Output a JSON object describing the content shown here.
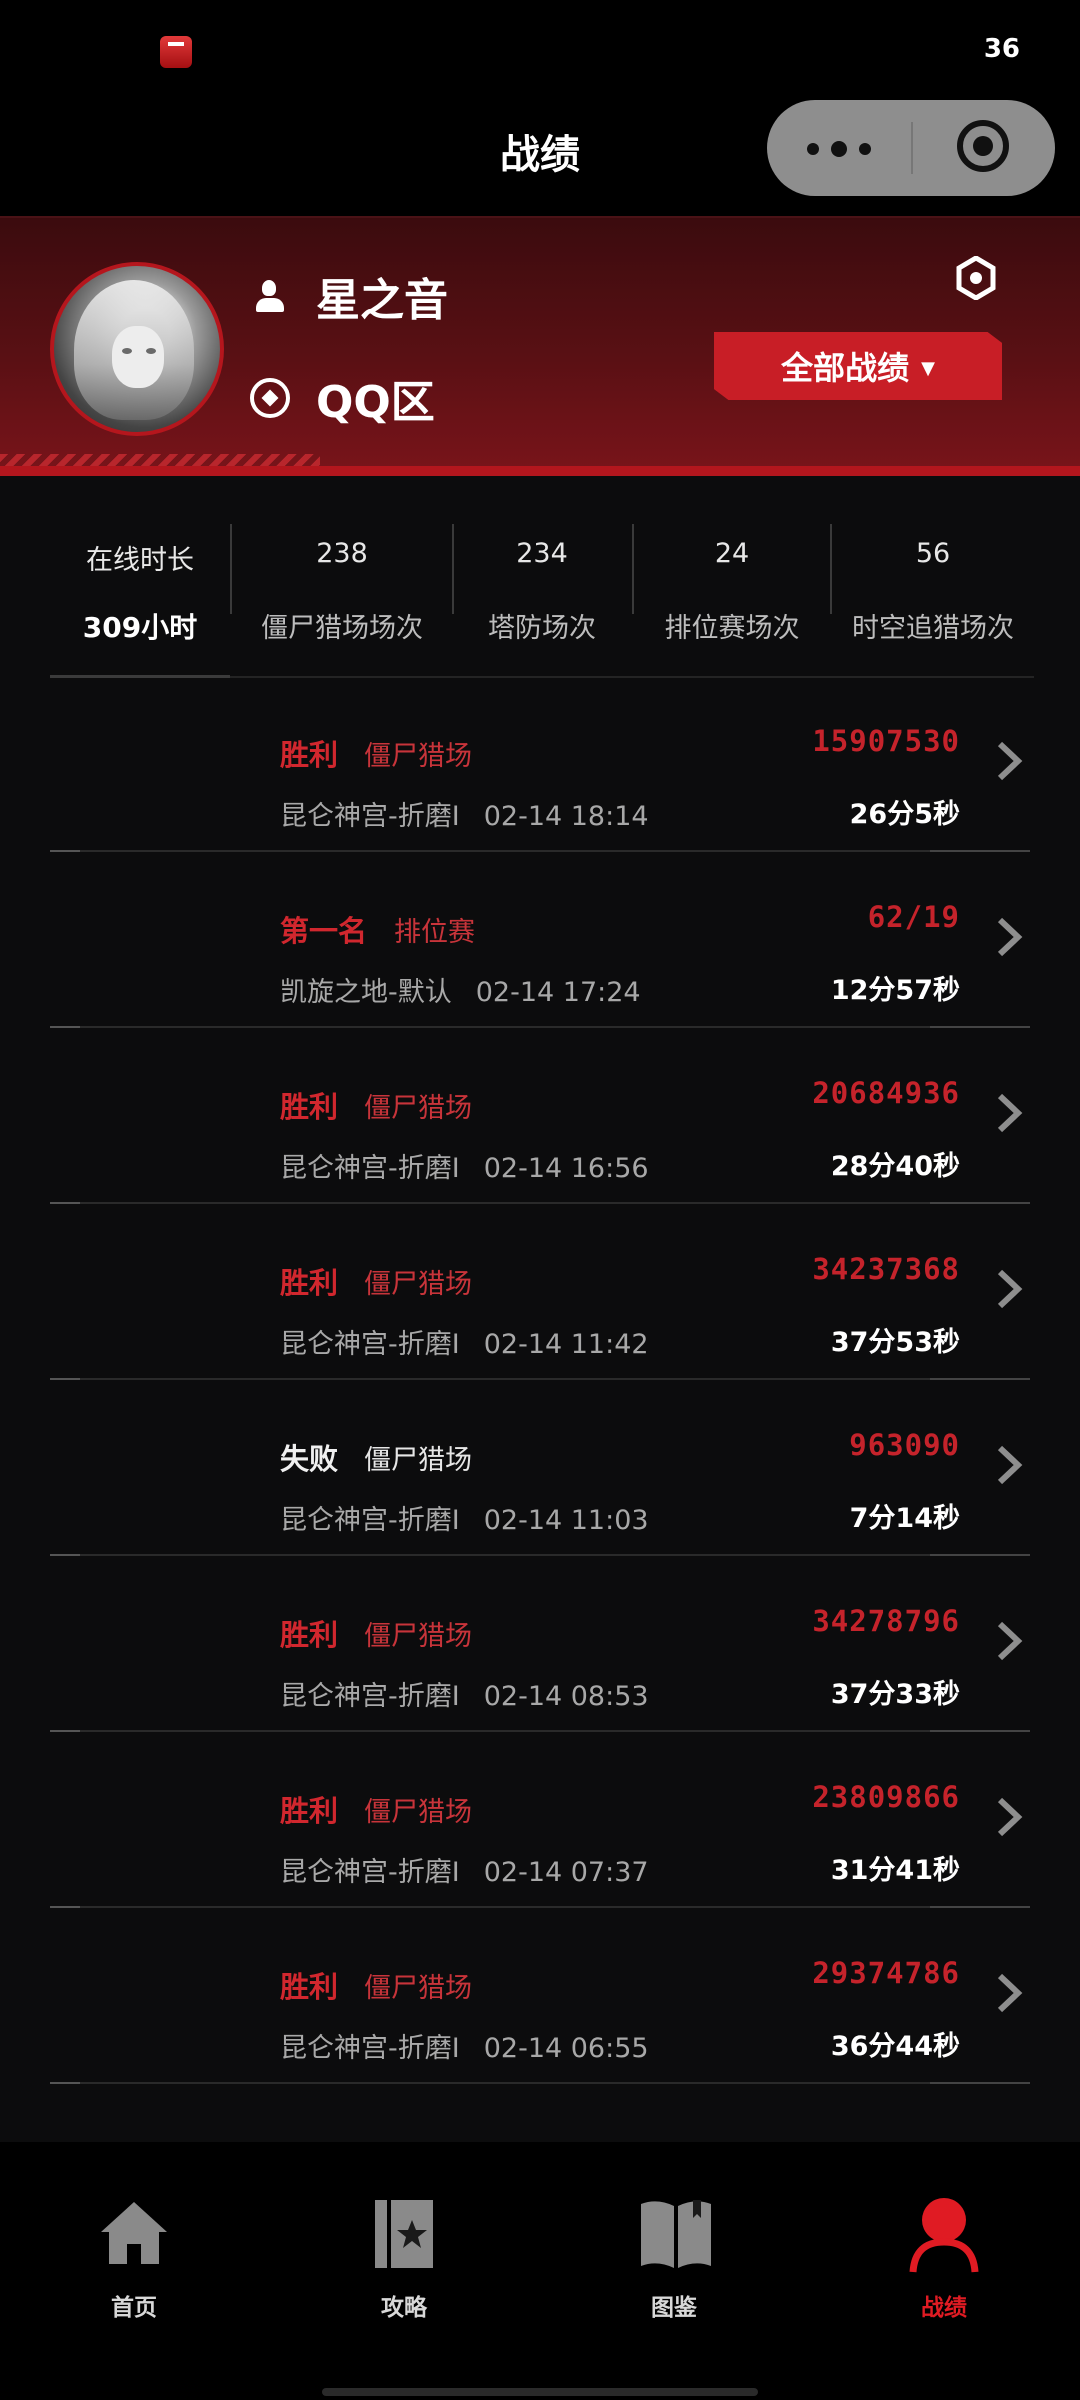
{
  "status": {
    "clock": "36"
  },
  "header": {
    "title": "战绩"
  },
  "profile": {
    "name": "星之音",
    "region": "QQ区",
    "filter_button": "全部战绩",
    "filter_caret": "▼"
  },
  "stats": {
    "online_label": "在线时长",
    "online_value": "309小时",
    "items": [
      {
        "value": "238",
        "label": "僵尸猎场场次"
      },
      {
        "value": "234",
        "label": "塔防场次"
      },
      {
        "value": "24",
        "label": "排位赛场次"
      },
      {
        "value": "56",
        "label": "时空追猎场次"
      }
    ]
  },
  "records": [
    {
      "result": "胜利",
      "result_color": "#d1272e",
      "mode": "僵尸猎场",
      "map": "昆仑神宫-折磨I",
      "time": "02-14 18:14",
      "score": "15907530",
      "duration": "26分5秒"
    },
    {
      "result": "第一名",
      "result_color": "#d1272e",
      "mode": "排位赛",
      "map": "凯旋之地-默认",
      "time": "02-14 17:24",
      "score": "62/19",
      "duration": "12分57秒"
    },
    {
      "result": "胜利",
      "result_color": "#d1272e",
      "mode": "僵尸猎场",
      "map": "昆仑神宫-折磨I",
      "time": "02-14 16:56",
      "score": "20684936",
      "duration": "28分40秒"
    },
    {
      "result": "胜利",
      "result_color": "#d1272e",
      "mode": "僵尸猎场",
      "map": "昆仑神宫-折磨I",
      "time": "02-14 11:42",
      "score": "34237368",
      "duration": "37分53秒"
    },
    {
      "result": "失败",
      "result_color": "#f0f0f0",
      "mode": "僵尸猎场",
      "map": "昆仑神宫-折磨I",
      "time": "02-14 11:03",
      "score": "963090",
      "duration": "7分14秒"
    },
    {
      "result": "胜利",
      "result_color": "#d1272e",
      "mode": "僵尸猎场",
      "map": "昆仑神宫-折磨I",
      "time": "02-14 08:53",
      "score": "34278796",
      "duration": "37分33秒"
    },
    {
      "result": "胜利",
      "result_color": "#d1272e",
      "mode": "僵尸猎场",
      "map": "昆仑神宫-折磨I",
      "time": "02-14 07:37",
      "score": "23809866",
      "duration": "31分41秒"
    },
    {
      "result": "胜利",
      "result_color": "#d1272e",
      "mode": "僵尸猎场",
      "map": "昆仑神宫-折磨I",
      "time": "02-14 06:55",
      "score": "29374786",
      "duration": "36分44秒"
    }
  ],
  "nav": {
    "items": [
      {
        "label": "首页",
        "icon": "home-icon"
      },
      {
        "label": "攻略",
        "icon": "guide-card-icon"
      },
      {
        "label": "图鉴",
        "icon": "book-icon"
      },
      {
        "label": "战绩",
        "icon": "profile-icon",
        "active": true
      }
    ]
  },
  "colors": {
    "accent": "#d1272e",
    "background": "#0c0c0d",
    "header_gradient": "#5a1014"
  }
}
